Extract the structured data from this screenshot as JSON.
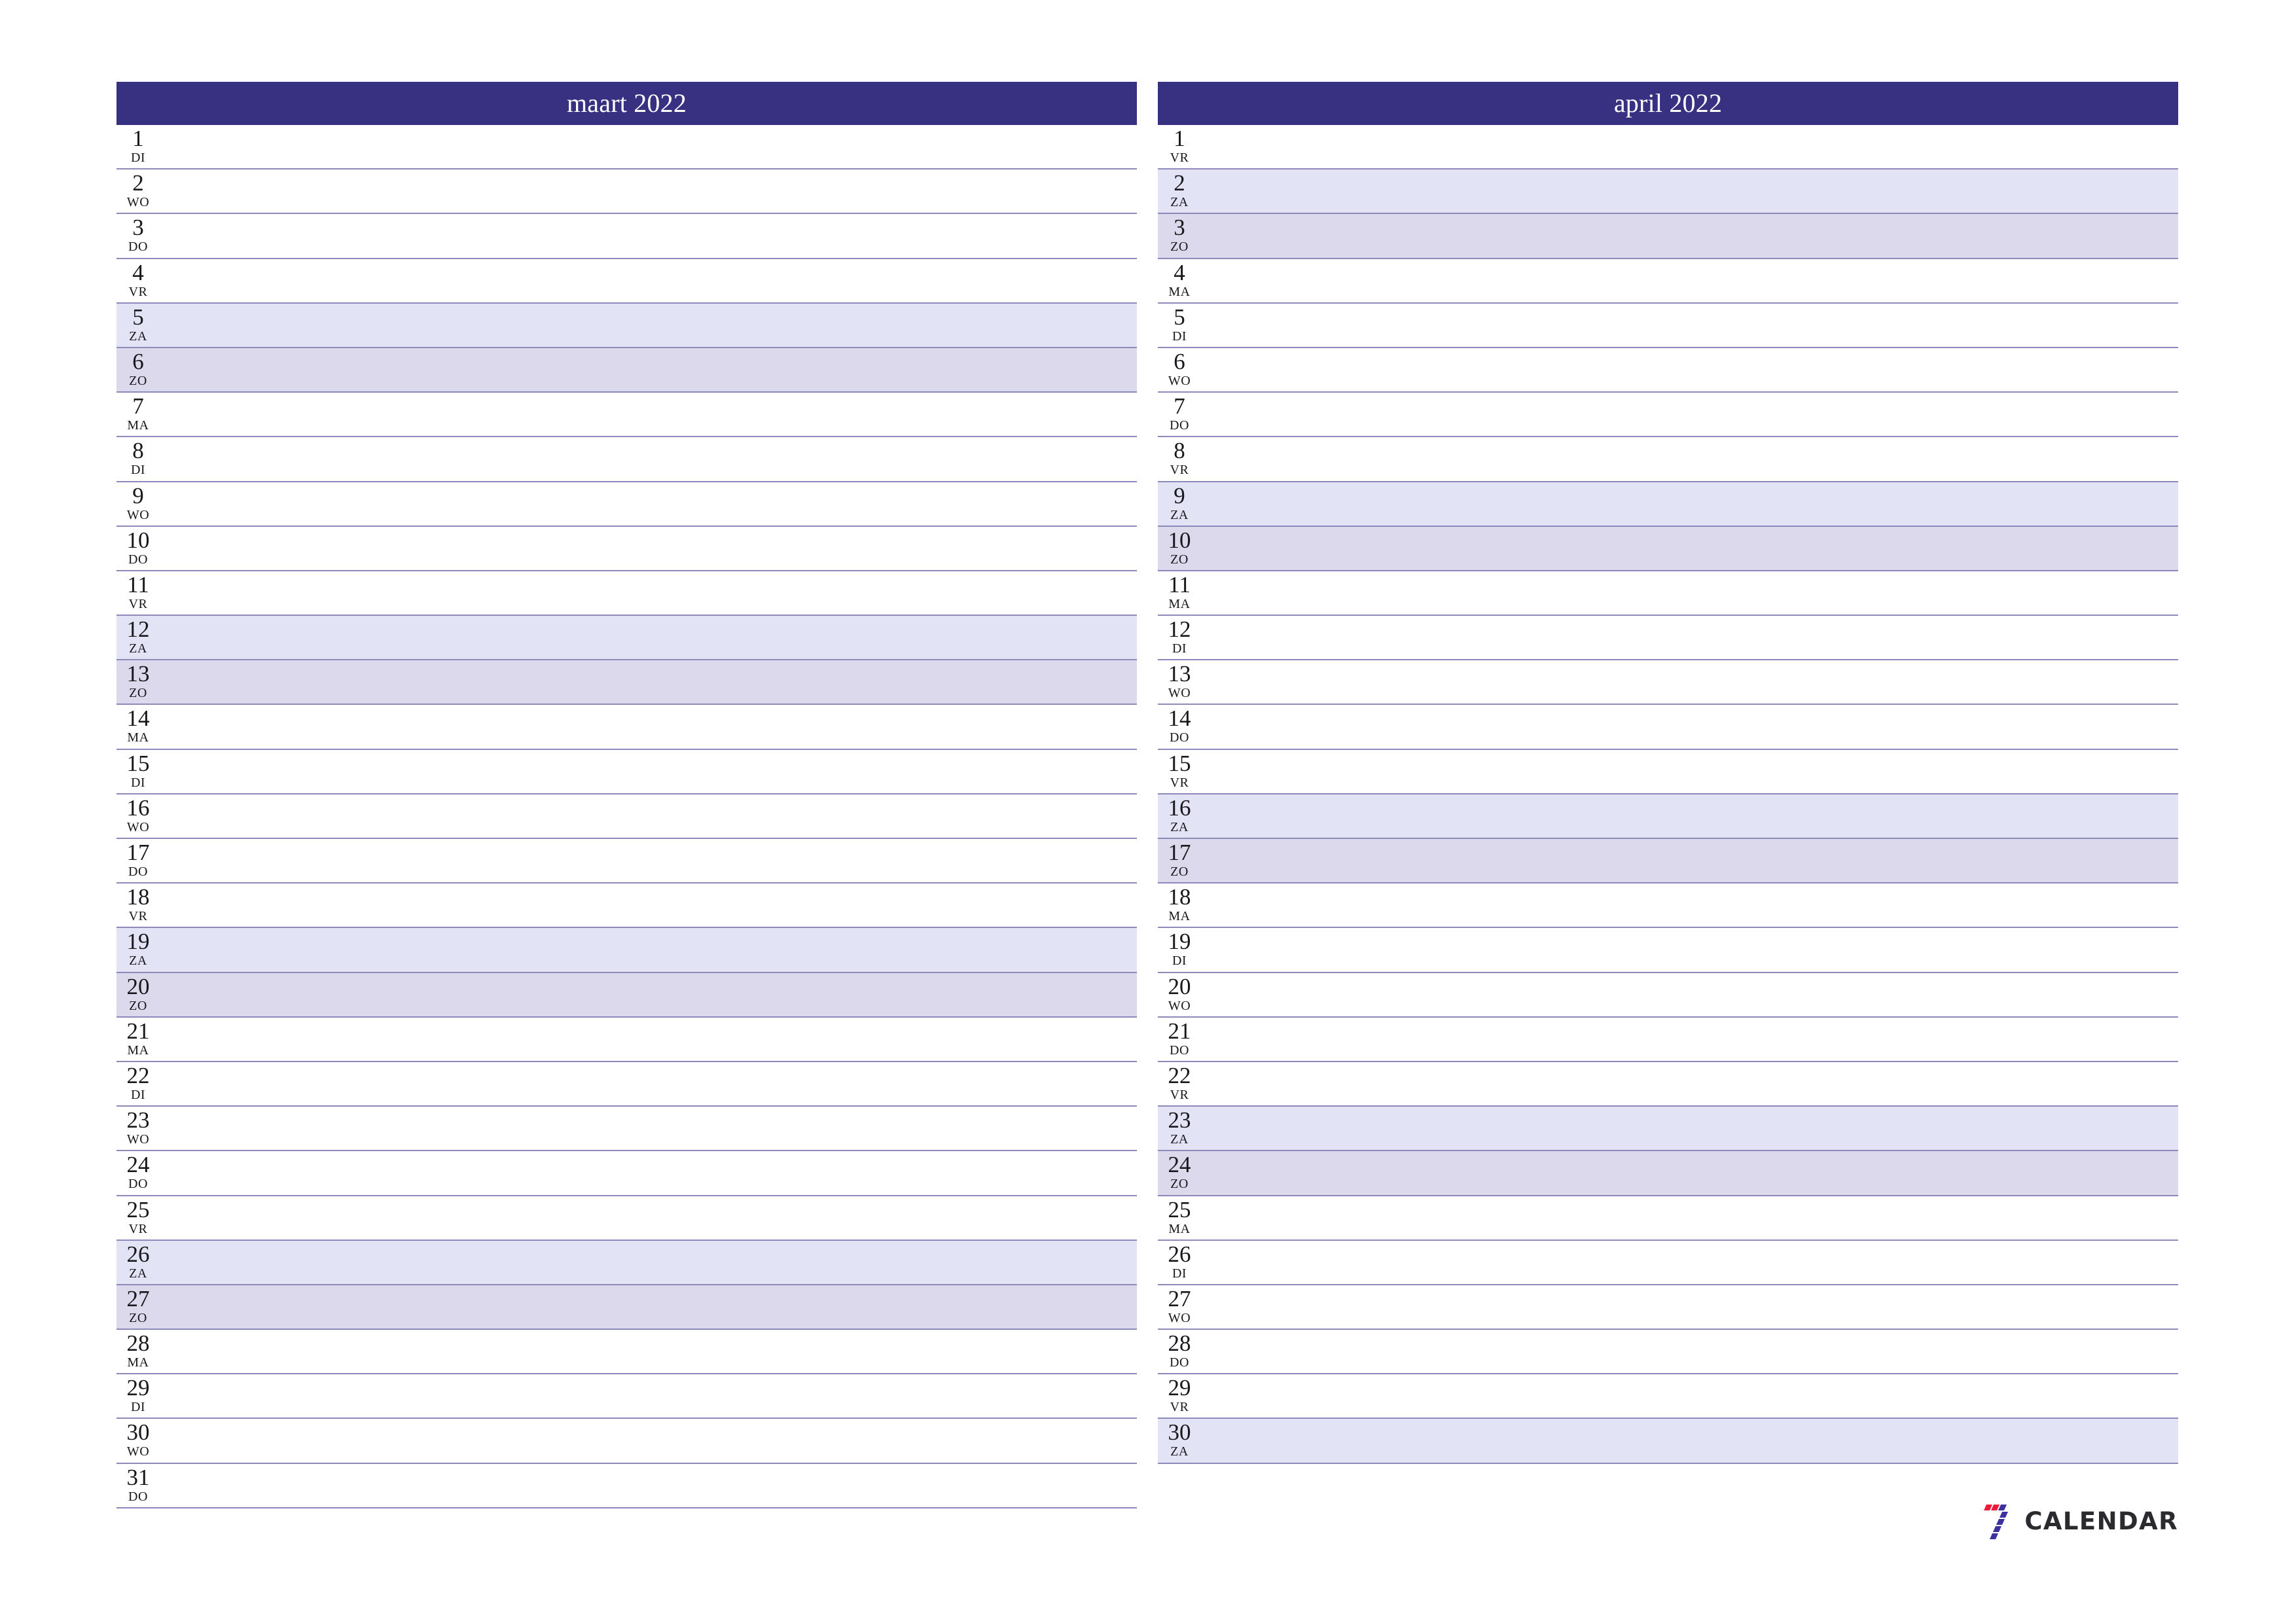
{
  "page": {
    "type": "printable-monthly-planner",
    "locale_hint": "nl",
    "colors": {
      "header_bg": "#383080",
      "header_text": "#ffffff",
      "rule": "#8d89ba",
      "saturday_bg": "#e3e3f6",
      "sunday_bg": "#ddd9ec",
      "day_text": "#17171c",
      "logo_red": "#ec1b3b",
      "logo_blue": "#3b31a0",
      "logo_text": "#2b2b2f"
    }
  },
  "brand": {
    "mark_name": "seven-stripes-logo",
    "text": "CALENDAR"
  },
  "months": [
    {
      "title": "maart 2022",
      "days": [
        {
          "num": "1",
          "weekday": "DI",
          "kind": "weekday"
        },
        {
          "num": "2",
          "weekday": "WO",
          "kind": "weekday"
        },
        {
          "num": "3",
          "weekday": "DO",
          "kind": "weekday"
        },
        {
          "num": "4",
          "weekday": "VR",
          "kind": "weekday"
        },
        {
          "num": "5",
          "weekday": "ZA",
          "kind": "saturday"
        },
        {
          "num": "6",
          "weekday": "ZO",
          "kind": "sunday"
        },
        {
          "num": "7",
          "weekday": "MA",
          "kind": "weekday"
        },
        {
          "num": "8",
          "weekday": "DI",
          "kind": "weekday"
        },
        {
          "num": "9",
          "weekday": "WO",
          "kind": "weekday"
        },
        {
          "num": "10",
          "weekday": "DO",
          "kind": "weekday"
        },
        {
          "num": "11",
          "weekday": "VR",
          "kind": "weekday"
        },
        {
          "num": "12",
          "weekday": "ZA",
          "kind": "saturday"
        },
        {
          "num": "13",
          "weekday": "ZO",
          "kind": "sunday"
        },
        {
          "num": "14",
          "weekday": "MA",
          "kind": "weekday"
        },
        {
          "num": "15",
          "weekday": "DI",
          "kind": "weekday"
        },
        {
          "num": "16",
          "weekday": "WO",
          "kind": "weekday"
        },
        {
          "num": "17",
          "weekday": "DO",
          "kind": "weekday"
        },
        {
          "num": "18",
          "weekday": "VR",
          "kind": "weekday"
        },
        {
          "num": "19",
          "weekday": "ZA",
          "kind": "saturday"
        },
        {
          "num": "20",
          "weekday": "ZO",
          "kind": "sunday"
        },
        {
          "num": "21",
          "weekday": "MA",
          "kind": "weekday"
        },
        {
          "num": "22",
          "weekday": "DI",
          "kind": "weekday"
        },
        {
          "num": "23",
          "weekday": "WO",
          "kind": "weekday"
        },
        {
          "num": "24",
          "weekday": "DO",
          "kind": "weekday"
        },
        {
          "num": "25",
          "weekday": "VR",
          "kind": "weekday"
        },
        {
          "num": "26",
          "weekday": "ZA",
          "kind": "saturday"
        },
        {
          "num": "27",
          "weekday": "ZO",
          "kind": "sunday"
        },
        {
          "num": "28",
          "weekday": "MA",
          "kind": "weekday"
        },
        {
          "num": "29",
          "weekday": "DI",
          "kind": "weekday"
        },
        {
          "num": "30",
          "weekday": "WO",
          "kind": "weekday"
        },
        {
          "num": "31",
          "weekday": "DO",
          "kind": "weekday"
        }
      ]
    },
    {
      "title": "april 2022",
      "days": [
        {
          "num": "1",
          "weekday": "VR",
          "kind": "weekday"
        },
        {
          "num": "2",
          "weekday": "ZA",
          "kind": "saturday"
        },
        {
          "num": "3",
          "weekday": "ZO",
          "kind": "sunday"
        },
        {
          "num": "4",
          "weekday": "MA",
          "kind": "weekday"
        },
        {
          "num": "5",
          "weekday": "DI",
          "kind": "weekday"
        },
        {
          "num": "6",
          "weekday": "WO",
          "kind": "weekday"
        },
        {
          "num": "7",
          "weekday": "DO",
          "kind": "weekday"
        },
        {
          "num": "8",
          "weekday": "VR",
          "kind": "weekday"
        },
        {
          "num": "9",
          "weekday": "ZA",
          "kind": "saturday"
        },
        {
          "num": "10",
          "weekday": "ZO",
          "kind": "sunday"
        },
        {
          "num": "11",
          "weekday": "MA",
          "kind": "weekday"
        },
        {
          "num": "12",
          "weekday": "DI",
          "kind": "weekday"
        },
        {
          "num": "13",
          "weekday": "WO",
          "kind": "weekday"
        },
        {
          "num": "14",
          "weekday": "DO",
          "kind": "weekday"
        },
        {
          "num": "15",
          "weekday": "VR",
          "kind": "weekday"
        },
        {
          "num": "16",
          "weekday": "ZA",
          "kind": "saturday"
        },
        {
          "num": "17",
          "weekday": "ZO",
          "kind": "sunday"
        },
        {
          "num": "18",
          "weekday": "MA",
          "kind": "weekday"
        },
        {
          "num": "19",
          "weekday": "DI",
          "kind": "weekday"
        },
        {
          "num": "20",
          "weekday": "WO",
          "kind": "weekday"
        },
        {
          "num": "21",
          "weekday": "DO",
          "kind": "weekday"
        },
        {
          "num": "22",
          "weekday": "VR",
          "kind": "weekday"
        },
        {
          "num": "23",
          "weekday": "ZA",
          "kind": "saturday"
        },
        {
          "num": "24",
          "weekday": "ZO",
          "kind": "sunday"
        },
        {
          "num": "25",
          "weekday": "MA",
          "kind": "weekday"
        },
        {
          "num": "26",
          "weekday": "DI",
          "kind": "weekday"
        },
        {
          "num": "27",
          "weekday": "WO",
          "kind": "weekday"
        },
        {
          "num": "28",
          "weekday": "DO",
          "kind": "weekday"
        },
        {
          "num": "29",
          "weekday": "VR",
          "kind": "weekday"
        },
        {
          "num": "30",
          "weekday": "ZA",
          "kind": "saturday"
        }
      ]
    }
  ]
}
